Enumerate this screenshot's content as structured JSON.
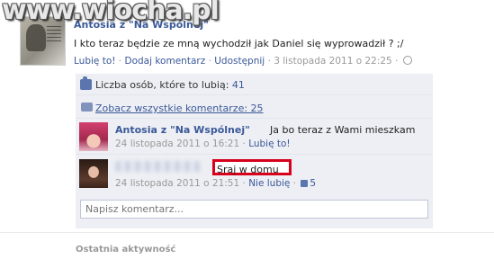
{
  "watermark": "www.wiocha.pl",
  "post": {
    "author": "Antosia z \"Na Wspólnej\"",
    "text": "I kto teraz będzie ze mną wychodził jak Daniel się wyprowadził ? ;/",
    "actions": {
      "like": "Lubię to!",
      "sep": "·",
      "comment": "Dodaj komentarz",
      "share": "Udostępnij",
      "time": "3 listopada 2011 o 22:25"
    }
  },
  "likes": {
    "text": "Liczba osób, które to lubią: ",
    "count": "41"
  },
  "all_comments": {
    "text": "Zobacz wszystkie komentarze: 25"
  },
  "comments": [
    {
      "author": "Antosia z \"Na Wspólnej\"",
      "text": "Ja bo teraz z Wami mieszkam",
      "time": "24 listopada 2011 o 16:21",
      "action": "Lubię to!"
    },
    {
      "text": "Sraj w domu",
      "time": "24 listopada 2011 o 21:51",
      "action": "Nie lubię",
      "likes": "5"
    }
  ],
  "comment_input": {
    "placeholder": "Napisz komentarz..."
  },
  "recent_activity": "Ostatnia aktywność",
  "colors": {
    "link": "#3b5998",
    "panel": "#edeff4",
    "highlight": "#d9001b"
  }
}
